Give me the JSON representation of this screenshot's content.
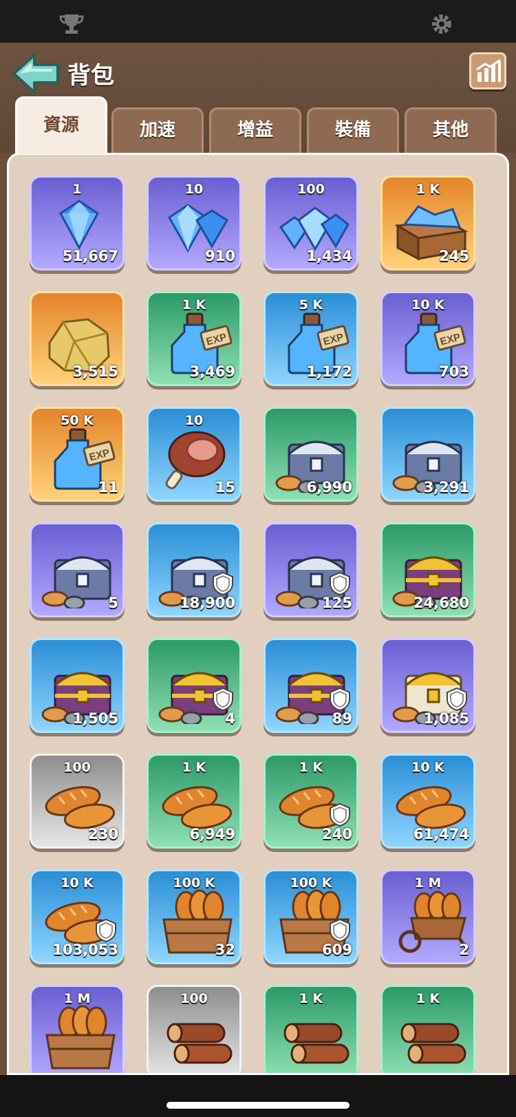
{
  "header": {
    "title": "背包"
  },
  "tabs": [
    {
      "label": "資源",
      "active": true
    },
    {
      "label": "加速",
      "active": false
    },
    {
      "label": "增益",
      "active": false
    },
    {
      "label": "裝備",
      "active": false
    },
    {
      "label": "其他",
      "active": false
    }
  ],
  "rarity_colors": {
    "purple": "#8a7de0",
    "orange": "#f0a238",
    "green": "#3fae79",
    "blue": "#3da7e8",
    "gray": "#b3b3b3"
  },
  "items": [
    {
      "icon": "gem-single-icon",
      "top": "1",
      "count": "51,667",
      "rarity": "purple",
      "shield": false
    },
    {
      "icon": "gem-pair-icon",
      "top": "10",
      "count": "910",
      "rarity": "purple",
      "shield": false
    },
    {
      "icon": "gem-pile-icon",
      "top": "100",
      "count": "1,434",
      "rarity": "purple",
      "shield": false
    },
    {
      "icon": "gem-crate-icon",
      "top": "1 K",
      "count": "245",
      "rarity": "orange",
      "shield": false
    },
    {
      "icon": "gold-ore-icon",
      "top": "",
      "count": "3,515",
      "rarity": "orange",
      "shield": false
    },
    {
      "icon": "exp-potion-icon",
      "top": "1 K",
      "count": "3,469",
      "rarity": "green",
      "shield": false
    },
    {
      "icon": "exp-potion-icon",
      "top": "5 K",
      "count": "1,172",
      "rarity": "blue",
      "shield": false
    },
    {
      "icon": "exp-potion-icon",
      "top": "10 K",
      "count": "703",
      "rarity": "purple",
      "shield": false
    },
    {
      "icon": "exp-potion-icon",
      "top": "50 K",
      "count": "11",
      "rarity": "orange",
      "shield": false
    },
    {
      "icon": "meat-icon",
      "top": "10",
      "count": "15",
      "rarity": "blue",
      "shield": false
    },
    {
      "icon": "silver-chest-icon",
      "top": "",
      "count": "6,990",
      "rarity": "green",
      "shield": false
    },
    {
      "icon": "silver-chest-icon",
      "top": "",
      "count": "3,291",
      "rarity": "blue",
      "shield": false
    },
    {
      "icon": "silver-chest-icon",
      "top": "",
      "count": "5",
      "rarity": "purple",
      "shield": false
    },
    {
      "icon": "silver-chest-icon",
      "top": "",
      "count": "18,900",
      "rarity": "blue",
      "shield": true
    },
    {
      "icon": "silver-chest-icon",
      "top": "",
      "count": "125",
      "rarity": "purple",
      "shield": true
    },
    {
      "icon": "gold-chest-icon",
      "top": "",
      "count": "24,680",
      "rarity": "green",
      "shield": false
    },
    {
      "icon": "gold-chest-icon",
      "top": "",
      "count": "1,505",
      "rarity": "blue",
      "shield": false
    },
    {
      "icon": "gold-chest-icon",
      "top": "",
      "count": "4",
      "rarity": "green",
      "shield": true
    },
    {
      "icon": "gold-chest-icon",
      "top": "",
      "count": "89",
      "rarity": "blue",
      "shield": true
    },
    {
      "icon": "white-gold-chest-icon",
      "top": "",
      "count": "1,085",
      "rarity": "purple",
      "shield": true
    },
    {
      "icon": "bread-icon",
      "top": "100",
      "count": "230",
      "rarity": "gray",
      "shield": false
    },
    {
      "icon": "bread-icon",
      "top": "1 K",
      "count": "6,949",
      "rarity": "green",
      "shield": false
    },
    {
      "icon": "bread-icon",
      "top": "1 K",
      "count": "240",
      "rarity": "green",
      "shield": true
    },
    {
      "icon": "bread-icon",
      "top": "10 K",
      "count": "61,474",
      "rarity": "blue",
      "shield": false
    },
    {
      "icon": "bread-icon",
      "top": "10 K",
      "count": "103,053",
      "rarity": "blue",
      "shield": true
    },
    {
      "icon": "bread-crate-icon",
      "top": "100 K",
      "count": "32",
      "rarity": "blue",
      "shield": false
    },
    {
      "icon": "bread-crate-icon",
      "top": "100 K",
      "count": "609",
      "rarity": "blue",
      "shield": true
    },
    {
      "icon": "bread-cart-icon",
      "top": "1 M",
      "count": "2",
      "rarity": "purple",
      "shield": false
    },
    {
      "icon": "bread-crate-icon",
      "top": "1 M",
      "count": "",
      "rarity": "purple",
      "shield": false
    },
    {
      "icon": "wood-log-icon",
      "top": "100",
      "count": "",
      "rarity": "gray",
      "shield": false
    },
    {
      "icon": "wood-log-icon",
      "top": "1 K",
      "count": "",
      "rarity": "green",
      "shield": false
    },
    {
      "icon": "wood-log-icon",
      "top": "1 K",
      "count": "",
      "rarity": "green",
      "shield": false
    }
  ]
}
